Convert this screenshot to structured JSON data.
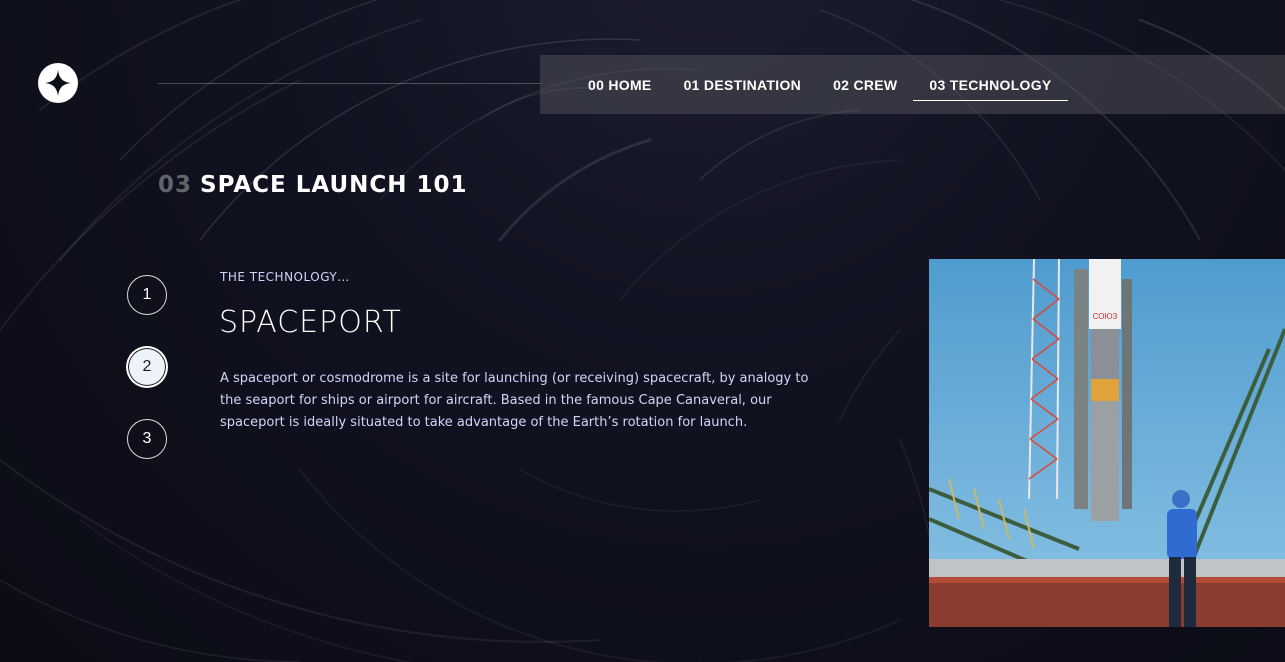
{
  "nav": {
    "items": [
      {
        "num": "00",
        "label": "00 HOME",
        "active": false
      },
      {
        "num": "01",
        "label": "01 DESTINATION",
        "active": false
      },
      {
        "num": "02",
        "label": "02 CREW",
        "active": false
      },
      {
        "num": "03",
        "label": "03 TECHNOLOGY",
        "active": true
      }
    ]
  },
  "logo": {
    "icon": "star-icon"
  },
  "page": {
    "number": "03",
    "title": "SPACE LAUNCH 101"
  },
  "steps": [
    {
      "label": "1",
      "active": false
    },
    {
      "label": "2",
      "active": true
    },
    {
      "label": "3",
      "active": false
    }
  ],
  "technology": {
    "eyebrow": "THE TECHNOLOGY…",
    "name": "SPACEPORT",
    "description": "A spaceport or cosmodrome is a site for launching (or receiving) spacecraft, by analogy to the seaport for ships or airport for aircraft. Based in the famous Cape Canaveral, our spaceport is ideally situated to take advantage of the Earth’s rotation for launch."
  },
  "colors": {
    "background": "#0b0d17",
    "text_secondary": "#d0d6f9",
    "accent": "#ffffff"
  }
}
